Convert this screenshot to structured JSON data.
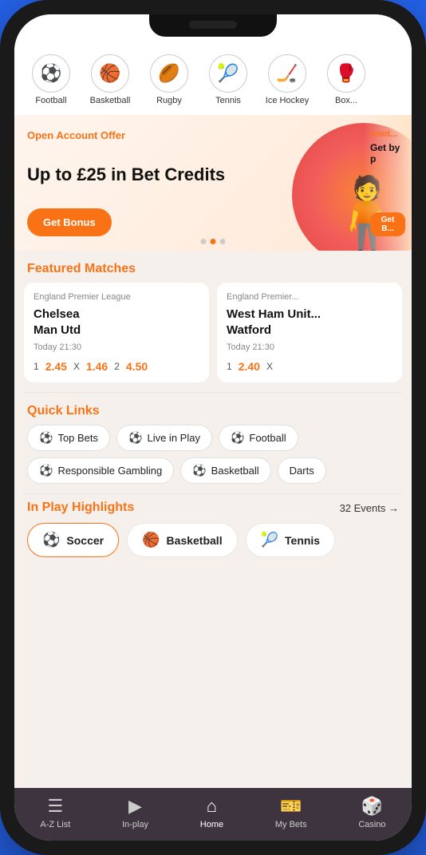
{
  "sports": [
    {
      "id": "football",
      "label": "Football",
      "icon": "⚽"
    },
    {
      "id": "basketball",
      "label": "Basketball",
      "icon": "🏀"
    },
    {
      "id": "rugby",
      "label": "Rugby",
      "icon": "🏈"
    },
    {
      "id": "tennis",
      "label": "Tennis",
      "icon": "🎾"
    },
    {
      "id": "icehockey",
      "label": "Ice Hockey",
      "icon": "🏒"
    },
    {
      "id": "boxing",
      "label": "Box...",
      "icon": "🥊"
    }
  ],
  "hero": {
    "offer_label": "Open Account Offer",
    "title": "Up to £25 in Bet Credits",
    "btn_label": "Get Bonus",
    "next_offer_label": "Anot...",
    "next_text": "Get by p",
    "next_btn": "Get B..."
  },
  "featured": {
    "section_title": "Featured Matches",
    "matches": [
      {
        "league": "England Premier League",
        "team1": "Chelsea",
        "team2": "Man Utd",
        "time": "Today 21:30",
        "odds": [
          {
            "label": "1",
            "val": "2.45"
          },
          {
            "label": "X",
            "val": "1.46"
          },
          {
            "label": "2",
            "val": "4.50"
          }
        ]
      },
      {
        "league": "England Premier...",
        "team1": "West Ham Unit...",
        "team2": "Watford",
        "time": "Today 21:30",
        "odds": [
          {
            "label": "1",
            "val": "2.40"
          },
          {
            "label": "X",
            "val": "..."
          }
        ]
      }
    ]
  },
  "quick_links": {
    "section_title": "Quick Links",
    "items": [
      {
        "label": "Top Bets"
      },
      {
        "label": "Live in Play"
      },
      {
        "label": "Football"
      },
      {
        "label": "Responsible Gambling"
      },
      {
        "label": "Basketball"
      },
      {
        "label": "Darts"
      }
    ]
  },
  "inplay": {
    "section_title": "In Play Highlights",
    "events_label": "32 Events →",
    "sports": [
      {
        "label": "Soccer",
        "icon": "⚽",
        "active": true
      },
      {
        "label": "Basketball",
        "icon": "🏀",
        "active": false
      },
      {
        "label": "Tennis",
        "icon": "🎾",
        "active": false
      }
    ]
  },
  "bottom_nav": [
    {
      "label": "A-Z List",
      "icon": "≡",
      "active": false
    },
    {
      "label": "In-play",
      "icon": "▶",
      "active": false
    },
    {
      "label": "Home",
      "icon": "⌂",
      "active": true
    },
    {
      "label": "My Bets",
      "icon": "🎫",
      "active": false
    },
    {
      "label": "Casino",
      "icon": "🎲",
      "active": false
    }
  ]
}
